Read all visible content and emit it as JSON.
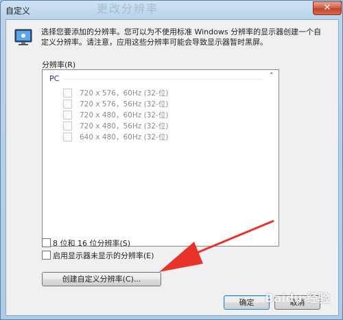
{
  "window": {
    "title": "自定义",
    "background_blur_text": "更改分辨率",
    "close_glyph": "✕"
  },
  "description": "选择您要添加的分辨率。您可以为不使用标准 Windows 分辨率的显示器创建一个自定义分辨率。请注意，应用这些分辨率可能会导致显示器暂时黑屏。",
  "resolutions": {
    "label": "分辨率(R)",
    "group": "PC",
    "items": [
      {
        "label": "720 x 576，60Hz (32-位)",
        "checked": false
      },
      {
        "label": "720 x 576，56Hz (32-位)",
        "checked": false
      },
      {
        "label": "720 x 480，60Hz (32-位)",
        "checked": false
      },
      {
        "label": "720 x 480，56Hz (32-位)",
        "checked": false
      },
      {
        "label": "640 x 480，60Hz (32-位)",
        "checked": false
      }
    ]
  },
  "options": {
    "bit_depth": "8 位和 16 位分辨率(S)",
    "unsupported": "启用显示器未显示的分辨率(E)"
  },
  "buttons": {
    "create": "创建自定义分辨率(C)...",
    "ok": "确定",
    "cancel": "取消"
  },
  "watermark": "Baidu 经验",
  "colors": {
    "arrow": "#e8332a",
    "group_header": "#1e3287"
  }
}
